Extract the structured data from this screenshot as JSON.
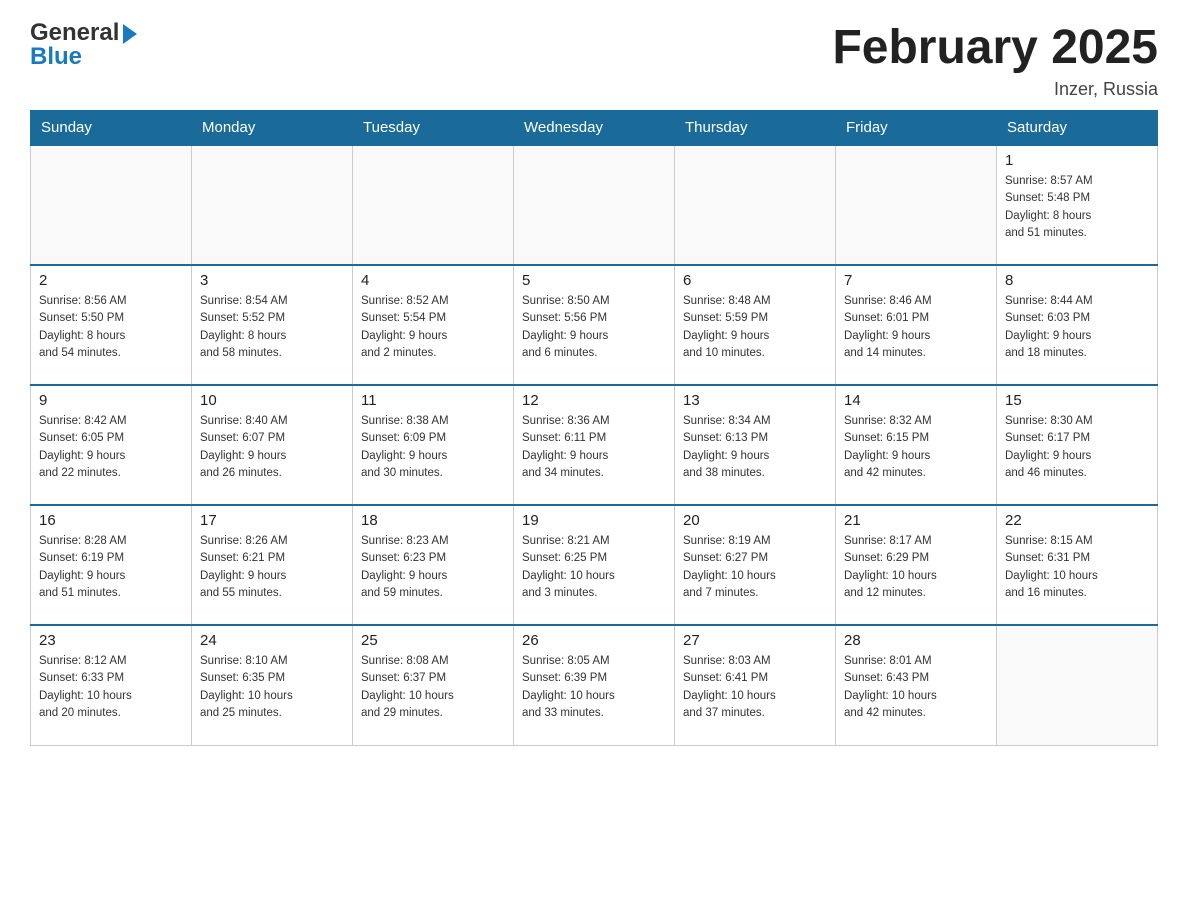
{
  "logo": {
    "general": "General",
    "blue": "Blue"
  },
  "title": "February 2025",
  "location": "Inzer, Russia",
  "days_of_week": [
    "Sunday",
    "Monday",
    "Tuesday",
    "Wednesday",
    "Thursday",
    "Friday",
    "Saturday"
  ],
  "weeks": [
    [
      {
        "day": "",
        "info": ""
      },
      {
        "day": "",
        "info": ""
      },
      {
        "day": "",
        "info": ""
      },
      {
        "day": "",
        "info": ""
      },
      {
        "day": "",
        "info": ""
      },
      {
        "day": "",
        "info": ""
      },
      {
        "day": "1",
        "info": "Sunrise: 8:57 AM\nSunset: 5:48 PM\nDaylight: 8 hours\nand 51 minutes."
      }
    ],
    [
      {
        "day": "2",
        "info": "Sunrise: 8:56 AM\nSunset: 5:50 PM\nDaylight: 8 hours\nand 54 minutes."
      },
      {
        "day": "3",
        "info": "Sunrise: 8:54 AM\nSunset: 5:52 PM\nDaylight: 8 hours\nand 58 minutes."
      },
      {
        "day": "4",
        "info": "Sunrise: 8:52 AM\nSunset: 5:54 PM\nDaylight: 9 hours\nand 2 minutes."
      },
      {
        "day": "5",
        "info": "Sunrise: 8:50 AM\nSunset: 5:56 PM\nDaylight: 9 hours\nand 6 minutes."
      },
      {
        "day": "6",
        "info": "Sunrise: 8:48 AM\nSunset: 5:59 PM\nDaylight: 9 hours\nand 10 minutes."
      },
      {
        "day": "7",
        "info": "Sunrise: 8:46 AM\nSunset: 6:01 PM\nDaylight: 9 hours\nand 14 minutes."
      },
      {
        "day": "8",
        "info": "Sunrise: 8:44 AM\nSunset: 6:03 PM\nDaylight: 9 hours\nand 18 minutes."
      }
    ],
    [
      {
        "day": "9",
        "info": "Sunrise: 8:42 AM\nSunset: 6:05 PM\nDaylight: 9 hours\nand 22 minutes."
      },
      {
        "day": "10",
        "info": "Sunrise: 8:40 AM\nSunset: 6:07 PM\nDaylight: 9 hours\nand 26 minutes."
      },
      {
        "day": "11",
        "info": "Sunrise: 8:38 AM\nSunset: 6:09 PM\nDaylight: 9 hours\nand 30 minutes."
      },
      {
        "day": "12",
        "info": "Sunrise: 8:36 AM\nSunset: 6:11 PM\nDaylight: 9 hours\nand 34 minutes."
      },
      {
        "day": "13",
        "info": "Sunrise: 8:34 AM\nSunset: 6:13 PM\nDaylight: 9 hours\nand 38 minutes."
      },
      {
        "day": "14",
        "info": "Sunrise: 8:32 AM\nSunset: 6:15 PM\nDaylight: 9 hours\nand 42 minutes."
      },
      {
        "day": "15",
        "info": "Sunrise: 8:30 AM\nSunset: 6:17 PM\nDaylight: 9 hours\nand 46 minutes."
      }
    ],
    [
      {
        "day": "16",
        "info": "Sunrise: 8:28 AM\nSunset: 6:19 PM\nDaylight: 9 hours\nand 51 minutes."
      },
      {
        "day": "17",
        "info": "Sunrise: 8:26 AM\nSunset: 6:21 PM\nDaylight: 9 hours\nand 55 minutes."
      },
      {
        "day": "18",
        "info": "Sunrise: 8:23 AM\nSunset: 6:23 PM\nDaylight: 9 hours\nand 59 minutes."
      },
      {
        "day": "19",
        "info": "Sunrise: 8:21 AM\nSunset: 6:25 PM\nDaylight: 10 hours\nand 3 minutes."
      },
      {
        "day": "20",
        "info": "Sunrise: 8:19 AM\nSunset: 6:27 PM\nDaylight: 10 hours\nand 7 minutes."
      },
      {
        "day": "21",
        "info": "Sunrise: 8:17 AM\nSunset: 6:29 PM\nDaylight: 10 hours\nand 12 minutes."
      },
      {
        "day": "22",
        "info": "Sunrise: 8:15 AM\nSunset: 6:31 PM\nDaylight: 10 hours\nand 16 minutes."
      }
    ],
    [
      {
        "day": "23",
        "info": "Sunrise: 8:12 AM\nSunset: 6:33 PM\nDaylight: 10 hours\nand 20 minutes."
      },
      {
        "day": "24",
        "info": "Sunrise: 8:10 AM\nSunset: 6:35 PM\nDaylight: 10 hours\nand 25 minutes."
      },
      {
        "day": "25",
        "info": "Sunrise: 8:08 AM\nSunset: 6:37 PM\nDaylight: 10 hours\nand 29 minutes."
      },
      {
        "day": "26",
        "info": "Sunrise: 8:05 AM\nSunset: 6:39 PM\nDaylight: 10 hours\nand 33 minutes."
      },
      {
        "day": "27",
        "info": "Sunrise: 8:03 AM\nSunset: 6:41 PM\nDaylight: 10 hours\nand 37 minutes."
      },
      {
        "day": "28",
        "info": "Sunrise: 8:01 AM\nSunset: 6:43 PM\nDaylight: 10 hours\nand 42 minutes."
      },
      {
        "day": "",
        "info": ""
      }
    ]
  ]
}
